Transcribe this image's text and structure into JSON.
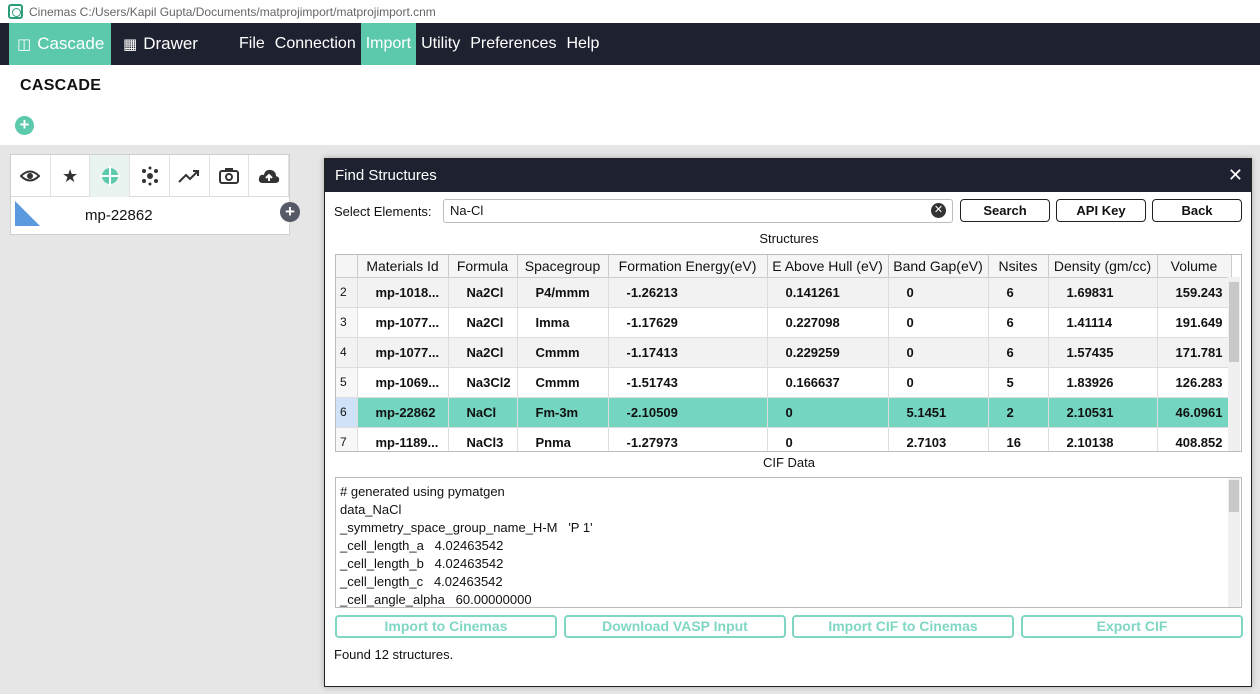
{
  "window": {
    "title": "Cinemas C:/Users/Kapil Gupta/Documents/matprojimport/matprojimport.cnm"
  },
  "menubar": {
    "tabs": [
      {
        "label": "Cascade",
        "icon": "cascade-icon"
      },
      {
        "label": "Drawer",
        "icon": "drawer-icon"
      }
    ],
    "items": [
      "File",
      "Connection",
      "Import",
      "Utility",
      "Preferences",
      "Help"
    ],
    "active_item": "Import"
  },
  "cascade": {
    "title": "CASCADE"
  },
  "left_panel": {
    "tools": [
      "eye-icon",
      "star-icon",
      "crosshair-icon",
      "atoms-icon",
      "trend-icon",
      "camera-icon",
      "cloud-upload-icon"
    ],
    "structure_name": "mp-22862"
  },
  "dialog": {
    "title": "Find Structures",
    "select_label": "Select Elements:",
    "select_value": "Na-Cl",
    "buttons": {
      "search": "Search",
      "api_key": "API Key",
      "back": "Back"
    },
    "structures_label": "Structures",
    "table": {
      "columns": [
        "Materials Id",
        "Formula",
        "Spacegroup",
        "Formation Energy(eV)",
        "E Above Hull (eV)",
        "Band Gap(eV)",
        "Nsites",
        "Density (gm/cc)",
        "Volume"
      ],
      "rows": [
        {
          "n": "2",
          "cells": [
            "mp-1018...",
            "Na2Cl",
            "P4/mmm",
            "-1.26213",
            "0.141261",
            "0",
            "6",
            "1.69831",
            "159.243"
          ]
        },
        {
          "n": "3",
          "cells": [
            "mp-1077...",
            "Na2Cl",
            "Imma",
            "-1.17629",
            "0.227098",
            "0",
            "6",
            "1.41114",
            "191.649"
          ]
        },
        {
          "n": "4",
          "cells": [
            "mp-1077...",
            "Na2Cl",
            "Cmmm",
            "-1.17413",
            "0.229259",
            "0",
            "6",
            "1.57435",
            "171.781"
          ]
        },
        {
          "n": "5",
          "cells": [
            "mp-1069...",
            "Na3Cl2",
            "Cmmm",
            "-1.51743",
            "0.166637",
            "0",
            "5",
            "1.83926",
            "126.283"
          ]
        },
        {
          "n": "6",
          "cells": [
            "mp-22862",
            "NaCl",
            "Fm-3m",
            "-2.10509",
            "0",
            "5.1451",
            "2",
            "2.10531",
            "46.0961"
          ]
        },
        {
          "n": "7",
          "cells": [
            "mp-1189...",
            "NaCl3",
            "Pnma",
            "-1.27973",
            "0",
            "2.7103",
            "16",
            "2.10138",
            "408.852"
          ]
        }
      ],
      "selected_row": "6"
    },
    "cif_label": "CIF Data",
    "cif_lines": [
      "# generated using pymatgen",
      "data_NaCl",
      "_symmetry_space_group_name_H-M   'P 1'",
      "_cell_length_a   4.02463542",
      "_cell_length_b   4.02463542",
      "_cell_length_c   4.02463542",
      "_cell_angle_alpha   60.00000000"
    ],
    "actions": {
      "import": "Import to Cinemas",
      "download": "Download VASP Input",
      "import_cif": "Import CIF to Cinemas",
      "export": "Export CIF"
    },
    "status": "Found 12 structures."
  }
}
